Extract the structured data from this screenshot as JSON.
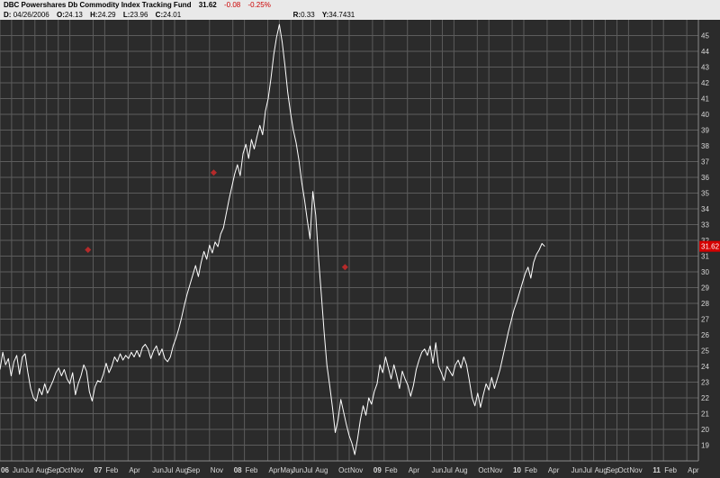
{
  "header": {
    "symbol_name": "DBC Powershares Db Commodity Index Tracking Fund",
    "last": "31.62",
    "change": "-0.08",
    "change_pct": "-0.25%",
    "date_label": "D:",
    "date": "04/26/2006",
    "open_label": "O:",
    "open": "24.13",
    "high_label": "H:",
    "high": "24.29",
    "low_label": "L:",
    "low": "23.96",
    "close_label": "C:",
    "close": "24.01",
    "r_label": "R:",
    "r": "0.33",
    "y_label": "Y:",
    "y": "34.7431"
  },
  "colors": {
    "background": "#2b2b2b",
    "grid": "#5c5c5c",
    "line": "#ffffff",
    "marker": "#b52a2a",
    "last_tag": "#d40000"
  },
  "chart_data": {
    "type": "line",
    "ylim": [
      18,
      46
    ],
    "yticks": [
      19,
      20,
      21,
      22,
      23,
      24,
      25,
      26,
      27,
      28,
      29,
      30,
      31,
      32,
      33,
      34,
      35,
      36,
      37,
      38,
      39,
      40,
      41,
      42,
      43,
      44,
      45
    ],
    "last_value_label": "31.62",
    "xticks": [
      {
        "t": 2006.0,
        "label": "06",
        "bold": true
      },
      {
        "t": 2006.083,
        "label": "Jun"
      },
      {
        "t": 2006.167,
        "label": "Jul"
      },
      {
        "t": 2006.25,
        "label": "Aug"
      },
      {
        "t": 2006.333,
        "label": "Sep"
      },
      {
        "t": 2006.417,
        "label": "Oct"
      },
      {
        "t": 2006.5,
        "label": "Nov"
      },
      {
        "t": 2006.667,
        "label": "07",
        "bold": true
      },
      {
        "t": 2006.75,
        "label": "Feb"
      },
      {
        "t": 2006.917,
        "label": "Apr"
      },
      {
        "t": 2007.083,
        "label": "Jun"
      },
      {
        "t": 2007.167,
        "label": "Jul"
      },
      {
        "t": 2007.25,
        "label": "Aug"
      },
      {
        "t": 2007.333,
        "label": "Sep"
      },
      {
        "t": 2007.5,
        "label": "Nov"
      },
      {
        "t": 2007.667,
        "label": "08",
        "bold": true
      },
      {
        "t": 2007.75,
        "label": "Feb"
      },
      {
        "t": 2007.917,
        "label": "Apr"
      },
      {
        "t": 2008.0,
        "label": "May"
      },
      {
        "t": 2008.083,
        "label": "Jun"
      },
      {
        "t": 2008.167,
        "label": "Jul"
      },
      {
        "t": 2008.25,
        "label": "Aug"
      },
      {
        "t": 2008.417,
        "label": "Oct"
      },
      {
        "t": 2008.5,
        "label": "Nov"
      },
      {
        "t": 2008.667,
        "label": "09",
        "bold": true
      },
      {
        "t": 2008.75,
        "label": "Feb"
      },
      {
        "t": 2008.917,
        "label": "Apr"
      },
      {
        "t": 2009.083,
        "label": "Jun"
      },
      {
        "t": 2009.167,
        "label": "Jul"
      },
      {
        "t": 2009.25,
        "label": "Aug"
      },
      {
        "t": 2009.417,
        "label": "Oct"
      },
      {
        "t": 2009.5,
        "label": "Nov"
      },
      {
        "t": 2009.667,
        "label": "10",
        "bold": true
      },
      {
        "t": 2009.75,
        "label": "Feb"
      },
      {
        "t": 2009.917,
        "label": "Apr"
      },
      {
        "t": 2010.083,
        "label": "Jun"
      },
      {
        "t": 2010.167,
        "label": "Jul"
      },
      {
        "t": 2010.25,
        "label": "Aug"
      },
      {
        "t": 2010.333,
        "label": "Sep"
      },
      {
        "t": 2010.417,
        "label": "Oct"
      },
      {
        "t": 2010.5,
        "label": "Nov"
      },
      {
        "t": 2010.667,
        "label": "11",
        "bold": true
      },
      {
        "t": 2010.75,
        "label": "Feb"
      },
      {
        "t": 2010.917,
        "label": "Apr"
      }
    ],
    "series": [
      {
        "values": [
          [
            2006.0,
            23.8
          ],
          [
            2006.02,
            24.9
          ],
          [
            2006.04,
            24.1
          ],
          [
            2006.06,
            24.5
          ],
          [
            2006.08,
            23.4
          ],
          [
            2006.1,
            24.3
          ],
          [
            2006.12,
            24.7
          ],
          [
            2006.14,
            23.5
          ],
          [
            2006.16,
            24.6
          ],
          [
            2006.18,
            24.8
          ],
          [
            2006.2,
            23.6
          ],
          [
            2006.22,
            22.6
          ],
          [
            2006.24,
            22.0
          ],
          [
            2006.26,
            21.8
          ],
          [
            2006.28,
            22.6
          ],
          [
            2006.3,
            22.2
          ],
          [
            2006.32,
            22.9
          ],
          [
            2006.34,
            22.3
          ],
          [
            2006.36,
            22.7
          ],
          [
            2006.38,
            23.1
          ],
          [
            2006.4,
            23.6
          ],
          [
            2006.42,
            23.9
          ],
          [
            2006.44,
            23.4
          ],
          [
            2006.46,
            23.8
          ],
          [
            2006.48,
            23.2
          ],
          [
            2006.5,
            22.9
          ],
          [
            2006.52,
            23.6
          ],
          [
            2006.54,
            22.2
          ],
          [
            2006.56,
            22.9
          ],
          [
            2006.58,
            23.4
          ],
          [
            2006.6,
            24.1
          ],
          [
            2006.62,
            23.7
          ],
          [
            2006.64,
            22.4
          ],
          [
            2006.66,
            21.8
          ],
          [
            2006.68,
            22.7
          ],
          [
            2006.7,
            23.1
          ],
          [
            2006.72,
            23.0
          ],
          [
            2006.74,
            23.5
          ],
          [
            2006.76,
            24.2
          ],
          [
            2006.78,
            23.6
          ],
          [
            2006.8,
            24.0
          ],
          [
            2006.82,
            24.6
          ],
          [
            2006.84,
            24.3
          ],
          [
            2006.86,
            24.8
          ],
          [
            2006.88,
            24.4
          ],
          [
            2006.9,
            24.7
          ],
          [
            2006.92,
            24.5
          ],
          [
            2006.94,
            24.9
          ],
          [
            2006.96,
            24.6
          ],
          [
            2006.98,
            25.0
          ],
          [
            2007.0,
            24.6
          ],
          [
            2007.02,
            25.2
          ],
          [
            2007.04,
            25.4
          ],
          [
            2007.06,
            25.1
          ],
          [
            2007.08,
            24.5
          ],
          [
            2007.1,
            25.0
          ],
          [
            2007.12,
            25.3
          ],
          [
            2007.14,
            24.7
          ],
          [
            2007.16,
            25.1
          ],
          [
            2007.18,
            24.5
          ],
          [
            2007.2,
            24.3
          ],
          [
            2007.22,
            24.6
          ],
          [
            2007.24,
            25.3
          ],
          [
            2007.26,
            25.8
          ],
          [
            2007.28,
            26.4
          ],
          [
            2007.3,
            27.1
          ],
          [
            2007.32,
            27.9
          ],
          [
            2007.34,
            28.6
          ],
          [
            2007.36,
            29.2
          ],
          [
            2007.38,
            29.8
          ],
          [
            2007.4,
            30.4
          ],
          [
            2007.42,
            29.7
          ],
          [
            2007.44,
            30.6
          ],
          [
            2007.46,
            31.3
          ],
          [
            2007.48,
            30.8
          ],
          [
            2007.5,
            31.7
          ],
          [
            2007.52,
            31.2
          ],
          [
            2007.54,
            31.9
          ],
          [
            2007.56,
            31.6
          ],
          [
            2007.58,
            32.4
          ],
          [
            2007.6,
            32.8
          ],
          [
            2007.62,
            33.7
          ],
          [
            2007.64,
            34.6
          ],
          [
            2007.66,
            35.4
          ],
          [
            2007.68,
            36.2
          ],
          [
            2007.7,
            36.8
          ],
          [
            2007.72,
            36.1
          ],
          [
            2007.74,
            37.5
          ],
          [
            2007.76,
            38.1
          ],
          [
            2007.78,
            37.2
          ],
          [
            2007.8,
            38.4
          ],
          [
            2007.82,
            37.8
          ],
          [
            2007.84,
            38.6
          ],
          [
            2007.86,
            39.3
          ],
          [
            2007.88,
            38.7
          ],
          [
            2007.9,
            40.2
          ],
          [
            2007.92,
            41.0
          ],
          [
            2007.94,
            42.3
          ],
          [
            2007.96,
            43.8
          ],
          [
            2007.98,
            44.9
          ],
          [
            2008.0,
            45.7
          ],
          [
            2008.02,
            44.6
          ],
          [
            2008.04,
            43.1
          ],
          [
            2008.06,
            41.4
          ],
          [
            2008.08,
            40.1
          ],
          [
            2008.1,
            39.0
          ],
          [
            2008.12,
            38.2
          ],
          [
            2008.14,
            37.1
          ],
          [
            2008.16,
            35.7
          ],
          [
            2008.18,
            34.6
          ],
          [
            2008.2,
            33.3
          ],
          [
            2008.22,
            32.1
          ],
          [
            2008.24,
            35.1
          ],
          [
            2008.26,
            33.6
          ],
          [
            2008.28,
            30.9
          ],
          [
            2008.3,
            28.6
          ],
          [
            2008.32,
            26.2
          ],
          [
            2008.34,
            24.1
          ],
          [
            2008.36,
            22.8
          ],
          [
            2008.38,
            21.4
          ],
          [
            2008.4,
            19.8
          ],
          [
            2008.42,
            20.6
          ],
          [
            2008.44,
            21.9
          ],
          [
            2008.46,
            21.1
          ],
          [
            2008.48,
            20.3
          ],
          [
            2008.5,
            19.6
          ],
          [
            2008.52,
            19.1
          ],
          [
            2008.54,
            18.4
          ],
          [
            2008.56,
            19.4
          ],
          [
            2008.58,
            20.6
          ],
          [
            2008.6,
            21.5
          ],
          [
            2008.62,
            20.9
          ],
          [
            2008.64,
            22.0
          ],
          [
            2008.66,
            21.6
          ],
          [
            2008.68,
            22.4
          ],
          [
            2008.7,
            22.9
          ],
          [
            2008.72,
            24.1
          ],
          [
            2008.74,
            23.6
          ],
          [
            2008.76,
            24.6
          ],
          [
            2008.78,
            23.9
          ],
          [
            2008.8,
            23.2
          ],
          [
            2008.82,
            24.1
          ],
          [
            2008.84,
            23.4
          ],
          [
            2008.86,
            22.6
          ],
          [
            2008.88,
            23.7
          ],
          [
            2008.9,
            23.2
          ],
          [
            2008.92,
            22.8
          ],
          [
            2008.94,
            22.1
          ],
          [
            2008.96,
            22.8
          ],
          [
            2008.98,
            23.8
          ],
          [
            2009.0,
            24.4
          ],
          [
            2009.02,
            24.9
          ],
          [
            2009.04,
            25.1
          ],
          [
            2009.06,
            24.7
          ],
          [
            2009.08,
            25.3
          ],
          [
            2009.1,
            24.2
          ],
          [
            2009.12,
            25.5
          ],
          [
            2009.14,
            24.0
          ],
          [
            2009.16,
            23.6
          ],
          [
            2009.18,
            23.1
          ],
          [
            2009.2,
            24.0
          ],
          [
            2009.22,
            23.7
          ],
          [
            2009.24,
            23.4
          ],
          [
            2009.26,
            24.1
          ],
          [
            2009.28,
            24.4
          ],
          [
            2009.3,
            23.9
          ],
          [
            2009.32,
            24.6
          ],
          [
            2009.34,
            24.1
          ],
          [
            2009.36,
            23.1
          ],
          [
            2009.38,
            22.0
          ],
          [
            2009.4,
            21.5
          ],
          [
            2009.42,
            22.3
          ],
          [
            2009.44,
            21.4
          ],
          [
            2009.46,
            22.2
          ],
          [
            2009.48,
            22.9
          ],
          [
            2009.5,
            22.5
          ],
          [
            2009.52,
            23.3
          ],
          [
            2009.54,
            22.6
          ],
          [
            2009.56,
            23.2
          ],
          [
            2009.58,
            23.8
          ],
          [
            2009.6,
            24.6
          ],
          [
            2009.62,
            25.4
          ],
          [
            2009.64,
            26.2
          ],
          [
            2009.66,
            26.9
          ],
          [
            2009.68,
            27.6
          ],
          [
            2009.7,
            28.1
          ],
          [
            2009.72,
            28.7
          ],
          [
            2009.74,
            29.3
          ],
          [
            2009.76,
            29.9
          ],
          [
            2009.78,
            30.3
          ],
          [
            2009.8,
            29.6
          ],
          [
            2009.82,
            30.6
          ],
          [
            2009.84,
            31.1
          ],
          [
            2009.86,
            31.4
          ],
          [
            2009.88,
            31.8
          ],
          [
            2009.9,
            31.62
          ]
        ]
      }
    ],
    "markers": [
      {
        "x": 2006.63,
        "y": 31.4
      },
      {
        "x": 2007.53,
        "y": 36.3
      },
      {
        "x": 2008.47,
        "y": 30.3
      }
    ]
  }
}
